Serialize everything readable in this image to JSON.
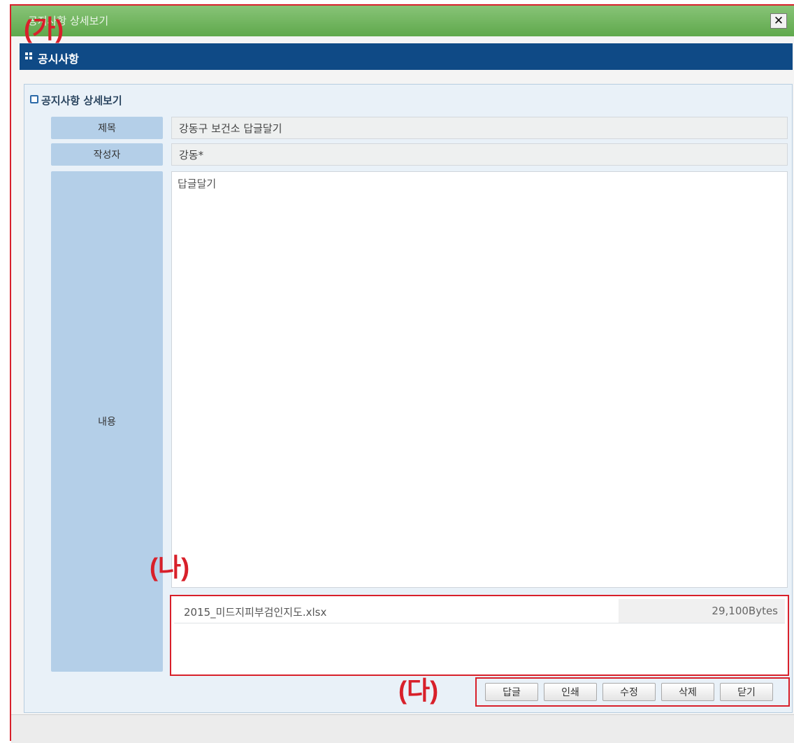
{
  "window": {
    "title": "공지사항 상세보기",
    "close_label": "✕"
  },
  "header": {
    "title": "공시사항"
  },
  "section": {
    "title": "공지사항 상세보기"
  },
  "fields": {
    "title_label": "제목",
    "title_value": "강동구 보건소 답글달기",
    "author_label": "작성자",
    "author_value": "강동*",
    "content_label": "내용",
    "content_value": "답글달기"
  },
  "attachment": {
    "filename": "2015_미드지피부검인지도.xlsx",
    "size": "29,100Bytes"
  },
  "buttons": [
    "답글",
    "인쇄",
    "수정",
    "삭제",
    "닫기"
  ],
  "markers": {
    "a": "(가)",
    "b": "(나)",
    "c": "(다)"
  },
  "colors": {
    "titlebar": "#6db35a",
    "header": "#0f4a86",
    "marker": "#d8202a",
    "label_bg": "#b4cfe8"
  }
}
